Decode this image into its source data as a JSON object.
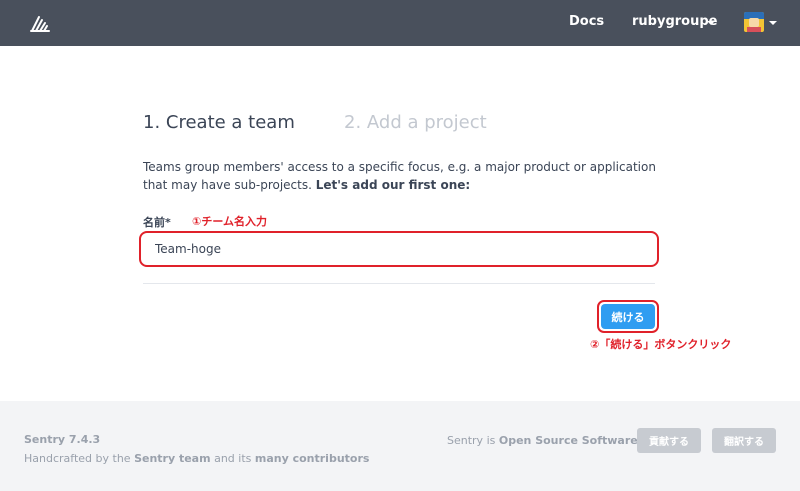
{
  "header": {
    "docs_label": "Docs",
    "org_name": "rubygroupe"
  },
  "steps": [
    {
      "label": "1. Create a team",
      "state": "active"
    },
    {
      "label": "2. Add a project",
      "state": "inactive"
    }
  ],
  "description": {
    "text": "Teams group members' access to a specific focus, e.g. a major product or application that may have sub-projects. ",
    "emphasis": "Let's add our first one:"
  },
  "form": {
    "name_label": "名前*",
    "name_value": "Team-hoge",
    "continue_label": "続ける"
  },
  "annotations": {
    "step1": "①チーム名入力",
    "step2": "②「続ける」ボタンクリック",
    "color": "#e0212a"
  },
  "footer": {
    "version": "Sentry 7.4.3",
    "credit_prefix": "Handcrafted by the ",
    "credit_team": "Sentry team",
    "credit_middle": " and its ",
    "credit_contributors": "many contributors",
    "oss_prefix": "Sentry is ",
    "oss_link": "Open Source Software",
    "contribute_label": "貢献する",
    "translate_label": "翻訳する"
  },
  "colors": {
    "topbar": "#49505c",
    "primary": "#2f9df1",
    "footer_bg": "#f3f4f6"
  },
  "icons": {
    "logo": "sentry-logo-icon",
    "caret": "chevron-down-icon"
  }
}
